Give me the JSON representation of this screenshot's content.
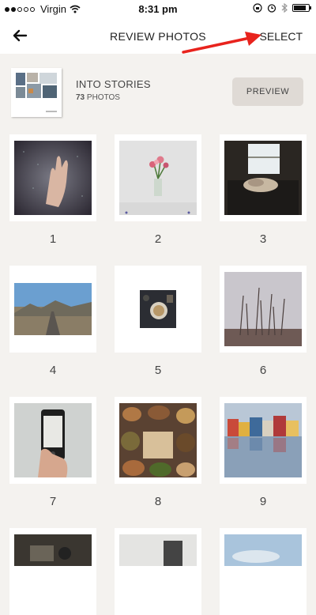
{
  "status_bar": {
    "carrier": "Virgin",
    "time": "8:31 pm",
    "battery_level": 0.85
  },
  "header": {
    "title": "REVIEW PHOTOS",
    "select_label": "SELECT"
  },
  "album": {
    "title": "INTO STORIES",
    "count": "73",
    "count_label": "PHOTOS",
    "preview_label": "PREVIEW"
  },
  "photos": [
    {
      "number": "1",
      "subject": "hand on rainy window"
    },
    {
      "number": "2",
      "subject": "flowers in glass vase"
    },
    {
      "number": "3",
      "subject": "dog sleeping by window"
    },
    {
      "number": "4",
      "subject": "road through mountains"
    },
    {
      "number": "5",
      "subject": "food bowl from above"
    },
    {
      "number": "6",
      "subject": "grass silhouette at dusk"
    },
    {
      "number": "7",
      "subject": "hand holding phone"
    },
    {
      "number": "8",
      "subject": "spice market baskets"
    },
    {
      "number": "9",
      "subject": "colorful houses by water"
    }
  ],
  "colors": {
    "background": "#f4f2ef",
    "preview_button": "#dfdad5",
    "annotation_arrow": "#e8231d"
  }
}
